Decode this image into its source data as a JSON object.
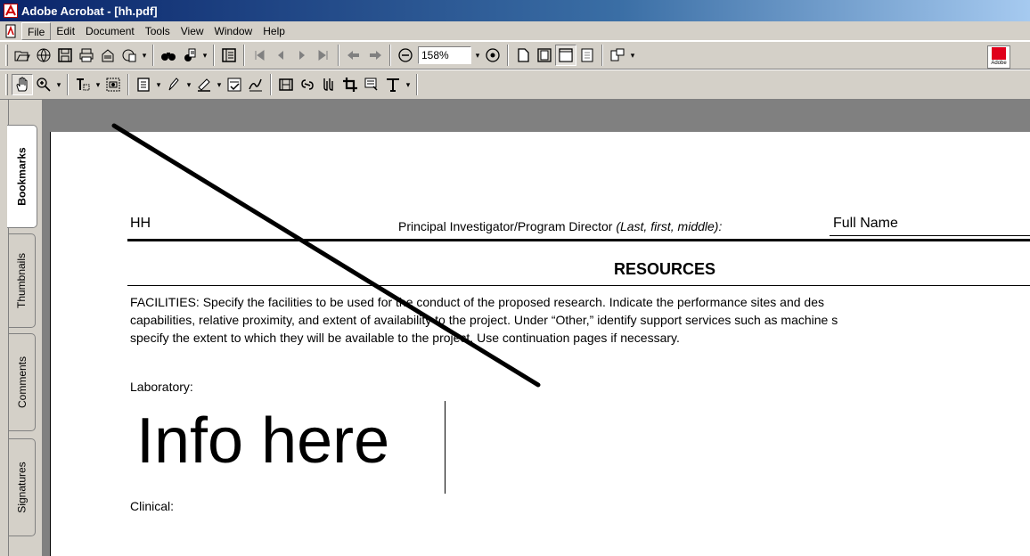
{
  "window": {
    "title": "Adobe Acrobat - [hh.pdf]"
  },
  "menu": [
    "File",
    "Edit",
    "Document",
    "Tools",
    "View",
    "Window",
    "Help"
  ],
  "toolbar": {
    "zoom_value": "158%"
  },
  "adobe_badge": "Adobe",
  "nav_tabs": [
    "Bookmarks",
    "Thumbnails",
    "Comments",
    "Signatures"
  ],
  "document": {
    "header_id": "HH",
    "pi_label": "Principal Investigator/Program Director",
    "pi_label_hint": "(Last, first, middle):",
    "pi_value": "Full Name",
    "section_title": "RESOURCES",
    "facilities_lines": [
      "FACILITIES:  Specify the facilities to be used for the conduct of the proposed research. Indicate the performance sites and des",
      "capabilities, relative proximity, and extent of availability to the project. Under “Other,” identify support services such as machine s",
      "specify the extent to which they will be available to the project. Use continuation pages if necessary."
    ],
    "laboratory_label": "Laboratory:",
    "laboratory_value": "Info here",
    "clinical_label": "Clinical:"
  },
  "colors": {
    "annotation_line": "#000000",
    "title_bar": "#0a246a"
  }
}
